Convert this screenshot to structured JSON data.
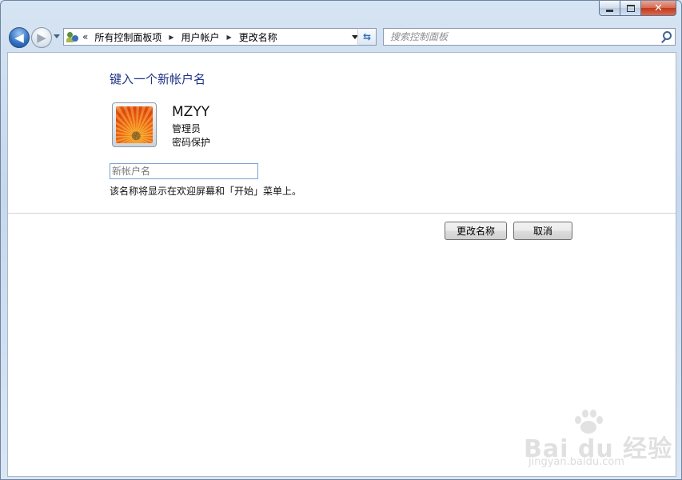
{
  "window": {
    "caption": {
      "minimize_glyph": "",
      "close_glyph": "✕"
    }
  },
  "navbar": {
    "back_glyph": "◀",
    "forward_glyph": "▶",
    "breadcrumb_overflow": "«",
    "breadcrumbs": [
      "所有控制面板项",
      "用户帐户",
      "更改名称"
    ],
    "separator": "▶",
    "refresh_glyph": "⇆",
    "search_placeholder": "搜索控制面板"
  },
  "main": {
    "title": "键入一个新帐户名",
    "account": {
      "name": "MZYY",
      "role": "管理员",
      "protection": "密码保护"
    },
    "new_name_input": {
      "value": "",
      "placeholder": "新帐户名"
    },
    "hint": "该名称将显示在欢迎屏幕和「开始」菜单上。",
    "buttons": {
      "rename": "更改名称",
      "cancel": "取消"
    }
  },
  "watermark": {
    "logo": "Bai du 经验",
    "url": "jingyan.baidu.com"
  },
  "colors": {
    "title_blue": "#1e3287",
    "chrome": "#c7d8ec",
    "close_red": "#c2381c"
  }
}
